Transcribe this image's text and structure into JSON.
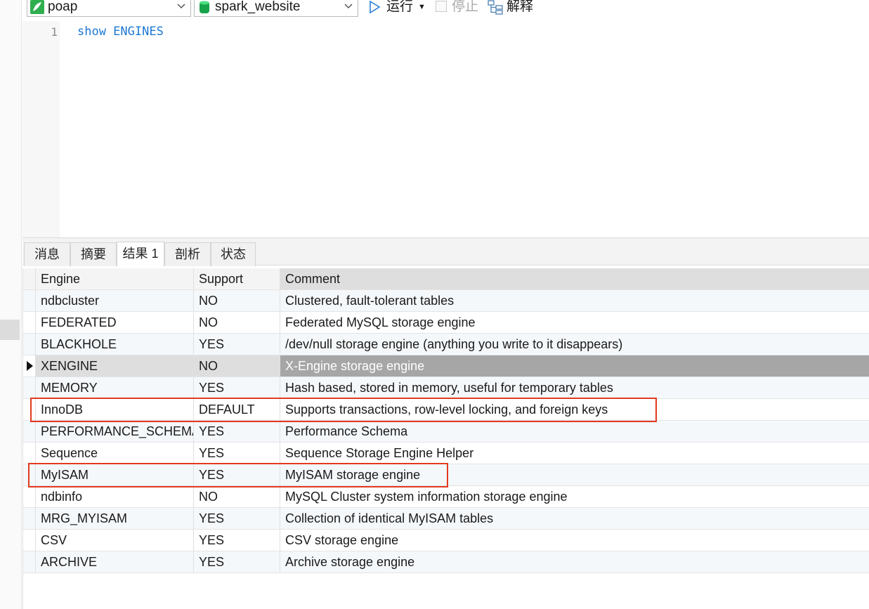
{
  "toolbar": {
    "connection": {
      "value": "poap",
      "icon": "connection-leaf-icon",
      "color": "#27a345"
    },
    "database": {
      "value": "spark_website",
      "icon": "database-icon",
      "color": "#17a34a"
    },
    "run_label": "运行",
    "stop_label": "停止",
    "explain_label": "解释"
  },
  "editor": {
    "line_number": "1",
    "code": "show ENGINES"
  },
  "tabs": [
    {
      "label": "消息"
    },
    {
      "label": "摘要"
    },
    {
      "label": "结果 1",
      "active": true
    },
    {
      "label": "剖析"
    },
    {
      "label": "状态"
    }
  ],
  "grid": {
    "columns": [
      "Engine",
      "Support",
      "Comment"
    ],
    "current_row": 3,
    "highlighted_rows": [
      5,
      8
    ],
    "highlight_color": "#e23a1e",
    "rows": [
      {
        "engine": "ndbcluster",
        "support": "NO",
        "comment": "Clustered, fault-tolerant tables"
      },
      {
        "engine": "FEDERATED",
        "support": "NO",
        "comment": "Federated MySQL storage engine"
      },
      {
        "engine": "BLACKHOLE",
        "support": "YES",
        "comment": "/dev/null storage engine (anything you write to it disappears)"
      },
      {
        "engine": "XENGINE",
        "support": "NO",
        "comment": "X-Engine storage engine"
      },
      {
        "engine": "MEMORY",
        "support": "YES",
        "comment": "Hash based, stored in memory, useful for temporary tables"
      },
      {
        "engine": "InnoDB",
        "support": "DEFAULT",
        "comment": "Supports transactions, row-level locking, and foreign keys"
      },
      {
        "engine": "PERFORMANCE_SCHEMA",
        "support": "YES",
        "comment": "Performance Schema"
      },
      {
        "engine": "Sequence",
        "support": "YES",
        "comment": "Sequence Storage Engine Helper"
      },
      {
        "engine": "MyISAM",
        "support": "YES",
        "comment": "MyISAM storage engine"
      },
      {
        "engine": "ndbinfo",
        "support": "NO",
        "comment": "MySQL Cluster system information storage engine"
      },
      {
        "engine": "MRG_MYISAM",
        "support": "YES",
        "comment": "Collection of identical MyISAM tables"
      },
      {
        "engine": "CSV",
        "support": "YES",
        "comment": "CSV storage engine"
      },
      {
        "engine": "ARCHIVE",
        "support": "YES",
        "comment": "Archive storage engine"
      }
    ]
  }
}
